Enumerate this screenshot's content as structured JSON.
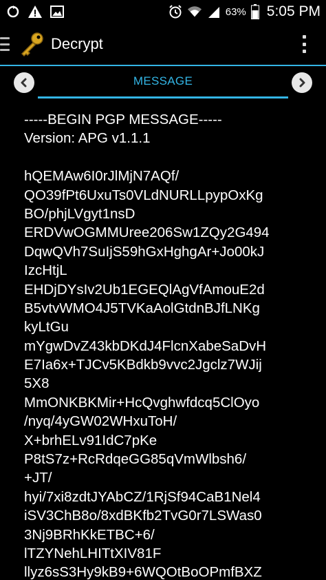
{
  "status_bar": {
    "icons_left": [
      "sync-icon",
      "warning-icon",
      "image-icon"
    ],
    "icons_right": [
      "alarm-icon",
      "wifi-icon",
      "signal-icon"
    ],
    "battery_text": "63%",
    "clock_text": "5:05 PM"
  },
  "action_bar": {
    "title": "Decrypt",
    "app_icon": "key-icon",
    "accent_color": "#33b5e5"
  },
  "pager": {
    "tab_label": "MESSAGE",
    "prev_icon": "chevron-left-icon",
    "next_icon": "chevron-right-icon"
  },
  "message": {
    "lines": [
      "-----BEGIN PGP MESSAGE-----",
      "Version: APG v1.1.1",
      "",
      "hQEMAw6I0rJlMjN7AQf/",
      "QO39fPt6UxuTs0VLdNURLLpypOxKg",
      "BO/phjLVgyt1nsD",
      "ERDVwOGMMUree206Sw1ZQy2G494",
      "DqwQVh7SuIjS59hGxHghgAr+Jo00kJ",
      "IzcHtjL",
      "EHDjDYsIv2Ub1EGEQlAgVfAmouE2d",
      "B5vtvWMO4J5TVKaAolGtdnBJfLNKg",
      "kyLtGu",
      "mYgwDvZ43kbDKdJ4FlcnXabeSaDvH",
      "E7Ia6x+TJCv5KBdkb9vvc2Jgclz7WJij",
      "5X8",
      "MmONKBKMir+HcQvghwfdcq5ClOyo",
      "/nyq/4yGW02WHxuToH/",
      "X+brhELv91IdC7pKe",
      "P8tS7z+RcRdqeGG85qVmWlbsh6/",
      "+JT/",
      "hyi/7xi8zdtJYAbCZ/1RjSf94CaB1Nel4",
      "iSV3ChB8o/8xdBKfb2TvG0r7LSWas0",
      "3Nj9BRhKkETBC+6/",
      "lTZYNehLHITtXIV81F",
      "llyz6sS3Hy9kB9+6WQOtBoOPmfBXZ"
    ]
  }
}
